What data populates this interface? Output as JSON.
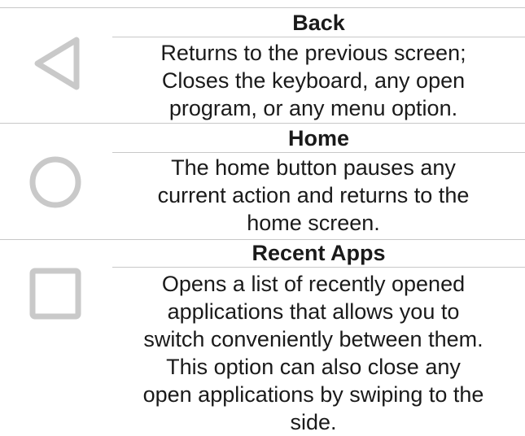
{
  "rows": [
    {
      "icon": "back-triangle-icon",
      "title": "Back",
      "description": "Returns to the previous screen;\nCloses the keyboard, any open\nprogram, or any menu option."
    },
    {
      "icon": "home-circle-icon",
      "title": "Home",
      "description": "The home button pauses any\ncurrent action and returns to the\nhome screen."
    },
    {
      "icon": "recent-apps-square-icon",
      "title": "Recent Apps",
      "description": "Opens a list of recently opened\napplications that allows you to\nswitch conveniently between them.\nThis option can also close any\nopen applications by swiping to the\nside."
    }
  ],
  "colors": {
    "icon_gray": "#c9c9c9",
    "rule_gray": "#c8c8c8",
    "text": "#1a1a1a"
  }
}
